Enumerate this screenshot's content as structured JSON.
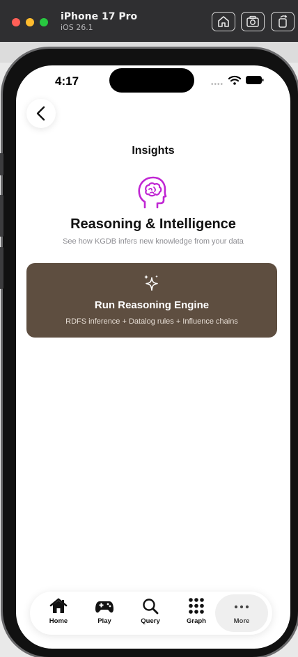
{
  "simulator": {
    "device_name": "iPhone 17 Pro",
    "os_version": "iOS 26.1"
  },
  "status_bar": {
    "time": "4:17"
  },
  "nav": {
    "title": "Insights"
  },
  "section": {
    "title": "Reasoning & Intelligence",
    "subtitle": "See how KGDB infers new knowledge from your data"
  },
  "run_card": {
    "title": "Run Reasoning Engine",
    "subtitle": "RDFS inference + Datalog rules + Influence chains"
  },
  "tabs": [
    {
      "label": "Home",
      "icon": "house-icon"
    },
    {
      "label": "Play",
      "icon": "gamecontroller-icon"
    },
    {
      "label": "Query",
      "icon": "magnifyingglass-icon"
    },
    {
      "label": "Graph",
      "icon": "grid-dots-icon"
    },
    {
      "label": "More",
      "icon": "ellipsis-icon"
    }
  ],
  "colors": {
    "card_background": "#5e4e40",
    "brain_icon": "#c026d3",
    "titlebar": "#2f2f31"
  }
}
